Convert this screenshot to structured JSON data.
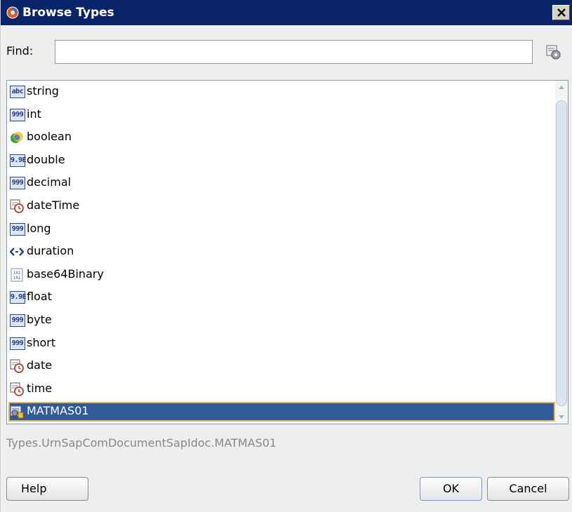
{
  "window": {
    "title": "Browse Types",
    "close_symbol": "×"
  },
  "find": {
    "label": "Find:",
    "value": "",
    "placeholder": ""
  },
  "types": [
    {
      "label": "string",
      "icon": "string-type-icon",
      "icon_text": "abc"
    },
    {
      "label": "int",
      "icon": "numeric-type-icon",
      "icon_text": "999"
    },
    {
      "label": "boolean",
      "icon": "boolean-type-icon",
      "icon_text": ""
    },
    {
      "label": "double",
      "icon": "float-type-icon",
      "icon_text": "9.9E"
    },
    {
      "label": "decimal",
      "icon": "numeric-type-icon",
      "icon_text": "999"
    },
    {
      "label": "dateTime",
      "icon": "date-type-icon",
      "icon_text": ""
    },
    {
      "label": "long",
      "icon": "numeric-type-icon",
      "icon_text": "999"
    },
    {
      "label": "duration",
      "icon": "duration-type-icon",
      "icon_text": ""
    },
    {
      "label": "base64Binary",
      "icon": "binary-type-icon",
      "icon_text": ""
    },
    {
      "label": "float",
      "icon": "float-type-icon",
      "icon_text": "9.9E"
    },
    {
      "label": "byte",
      "icon": "numeric-type-icon",
      "icon_text": "999"
    },
    {
      "label": "short",
      "icon": "numeric-type-icon",
      "icon_text": "999"
    },
    {
      "label": "date",
      "icon": "date-type-icon",
      "icon_text": ""
    },
    {
      "label": "time",
      "icon": "date-type-icon",
      "icon_text": ""
    },
    {
      "label": "MATMAS01",
      "icon": "complex-type-icon",
      "icon_text": "",
      "selected": true
    }
  ],
  "selected_path": "Types.UrnSapComDocumentSapIdoc.MATMAS01",
  "buttons": {
    "help": "Help",
    "ok": "OK",
    "cancel": "Cancel"
  },
  "colors": {
    "titlebar": "#0a246a",
    "selection": "#315a9a",
    "selection_border": "#e8b54c"
  }
}
